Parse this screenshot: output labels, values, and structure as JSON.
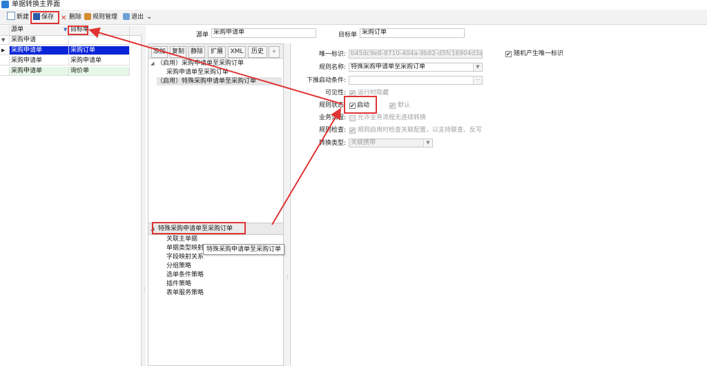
{
  "window": {
    "title": "单据转换主界面"
  },
  "toolbar": {
    "new_label": "新建",
    "save_label": "保存",
    "delete_label": "删除",
    "rule_manage_label": "规则管理",
    "exit_label": "退出",
    "more_glyph": "⌄"
  },
  "grid": {
    "columns": [
      "源单",
      "目标单"
    ],
    "filter_row": "采购申请",
    "rows": [
      {
        "source": "采购申请单",
        "target": "采购订单",
        "selected": true
      },
      {
        "source": "采购申请单",
        "target": "采购申请单",
        "selected": false
      },
      {
        "source": "采购申请单",
        "target": "询价单",
        "selected": false
      }
    ]
  },
  "header": {
    "source_label": "源单",
    "source_value": "采购申请单",
    "target_label": "目标单",
    "target_value": "采购订单"
  },
  "mid_tabs": [
    "添加",
    "复制",
    "静除",
    "扩展",
    "XML",
    "历史",
    "+"
  ],
  "rule_tree": {
    "items": [
      "（启用）采购申请单至采购订单",
      "采购申请单至采购订单",
      "（启用）特殊采购申请单至采购订单"
    ]
  },
  "lower_tree": {
    "header": "特殊采购申请单至采购订单",
    "items": [
      "关联主单据",
      "单据类型映射",
      "字段映射关系",
      "分组策略",
      "选单条件策略",
      "插件策略",
      "表单服务策略"
    ],
    "tooltip": "特殊采购申请单至采购订单"
  },
  "form": {
    "uid_label": "唯一标识:",
    "uid_value": "b45dc9e8-8710-404a-9b82-d5fc16904d3a",
    "random_uid_label": "随机产生唯一标识",
    "rule_name_label": "规则名称:",
    "rule_name_value": "特殊采购申请单至采购订单",
    "push_condition_label": "下推启动条件:",
    "push_condition_btn": "···",
    "visibility_label": "可见性:",
    "visibility_option": "运行时隐藏",
    "status_label": "规则状态:",
    "enabled_label": "启动",
    "default_label": "默认",
    "workflow_label": "业务流程:",
    "workflow_option": "允许业务流程无连续转换",
    "check_label": "规则检查:",
    "check_option": "规则启用时检查关联配置，以支持联查、反写",
    "convert_type_label": "转换类型:",
    "convert_type_value": "关联携带",
    "check_mark": "✔"
  },
  "colors": {
    "selected_row": "#0a24d8",
    "alt_row": "#e6f7e6",
    "annotation_red": "#e03333"
  }
}
